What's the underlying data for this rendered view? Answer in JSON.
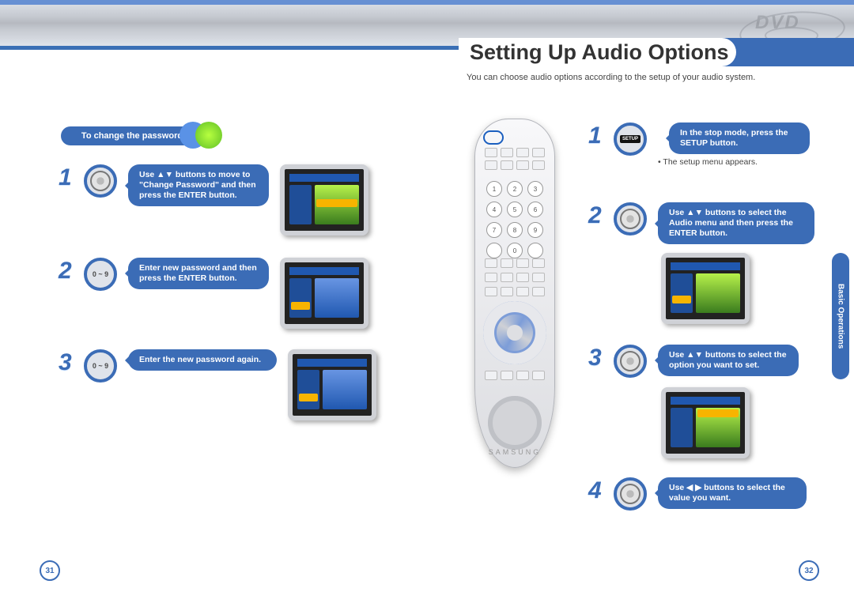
{
  "header": {
    "logo_text": "DVD"
  },
  "title": "Setting Up Audio Options",
  "intro": "You can choose audio options according to the setup of your audio system.",
  "left": {
    "header": "To change the password",
    "steps": [
      {
        "num": "1",
        "icon": "dpad",
        "text": "Use ▲▼ buttons to move to \"Change Password\" and then press the ENTER button."
      },
      {
        "num": "2",
        "icon_label": "0 ~ 9",
        "text": "Enter new password and then press the ENTER button."
      },
      {
        "num": "3",
        "icon_label": "0 ~ 9",
        "text": "Enter the new password again."
      }
    ]
  },
  "right": {
    "steps": [
      {
        "num": "1",
        "icon": "setup",
        "text": "In the stop mode, press the SETUP button.",
        "note": "• The setup menu appears."
      },
      {
        "num": "2",
        "icon": "dpad",
        "text": "Use ▲▼ buttons to select the Audio menu and then press the ENTER button."
      },
      {
        "num": "3",
        "icon": "dpad",
        "text": "Use ▲▼ buttons to select the option you want to set."
      },
      {
        "num": "4",
        "icon": "dpad",
        "text": "Use ◀ ▶ buttons to select the value you want."
      }
    ]
  },
  "remote": {
    "brand": "SAMSUNG",
    "numbers": [
      "1",
      "2",
      "3",
      "4",
      "5",
      "6",
      "7",
      "8",
      "9",
      "0"
    ]
  },
  "side_tab": "Basic Operations",
  "page_left": "31",
  "page_right": "32"
}
